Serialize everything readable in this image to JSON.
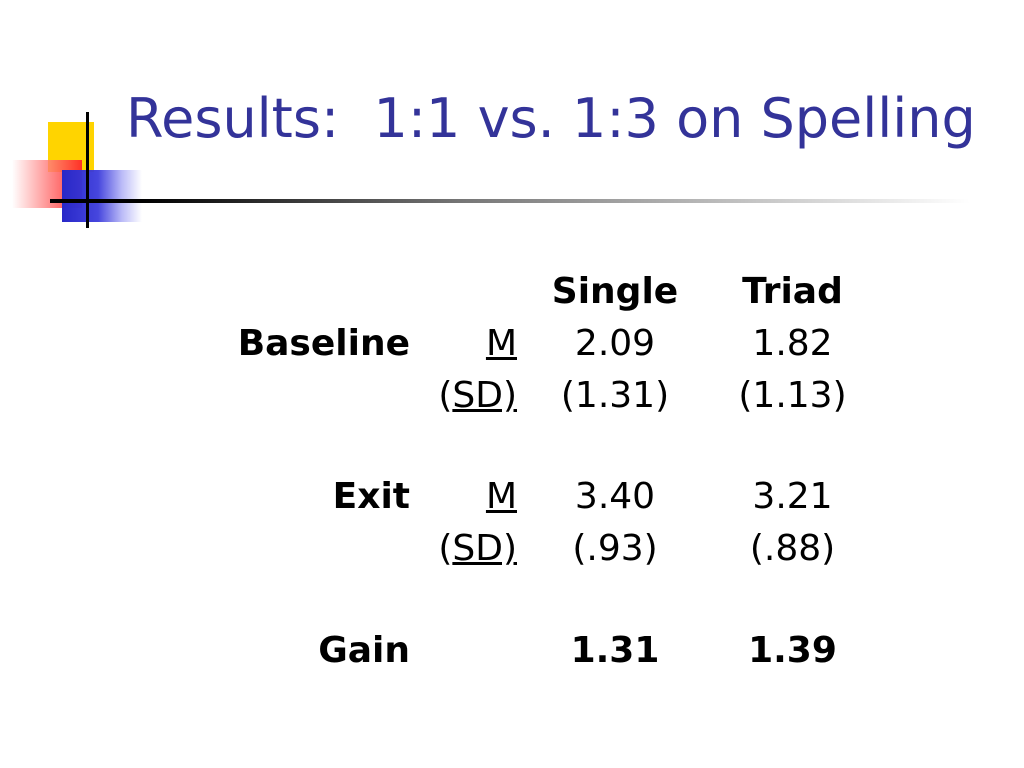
{
  "title": "Results:  1:1 vs. 1:3 on Spelling",
  "table": {
    "headers": {
      "single": "Single",
      "triad": "Triad"
    },
    "baseline": {
      "label": "Baseline",
      "m_label": "M",
      "sd_open": "(",
      "sd_label": "SD)",
      "single_m": "2.09",
      "triad_m": "1.82",
      "single_sd": "(1.31)",
      "triad_sd": "(1.13)"
    },
    "exit": {
      "label": "Exit",
      "m_label": "M",
      "sd_open": "(",
      "sd_label": "SD)",
      "single_m": "3.40",
      "triad_m": "3.21",
      "single_sd": "(.93)",
      "triad_sd": "(.88)"
    },
    "gain": {
      "label": "Gain",
      "single": "1.31",
      "triad": "1.39"
    }
  },
  "colors": {
    "title": "#333399",
    "text": "#000000",
    "logo_yellow": "#ffd400",
    "logo_red": "#ff2828",
    "logo_blue": "#2828c8"
  }
}
